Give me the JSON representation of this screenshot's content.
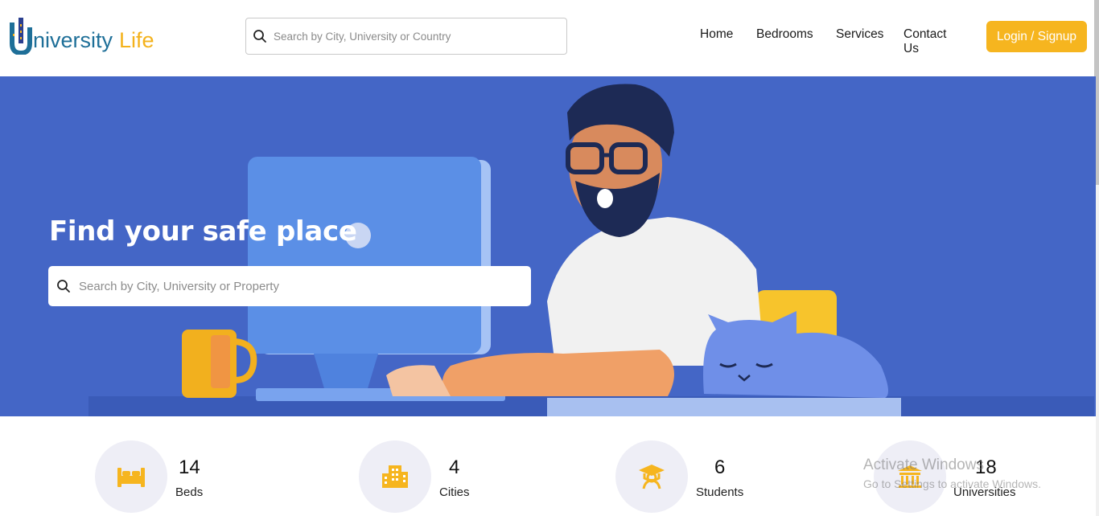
{
  "header": {
    "logo": {
      "text_1": "niversity",
      "text_2": "Life",
      "letter": "U"
    },
    "search": {
      "placeholder": "Search by City, University or Country",
      "value": ""
    },
    "nav": [
      {
        "label": "Home"
      },
      {
        "label": "Bedrooms"
      },
      {
        "label": "Services"
      },
      {
        "label": "Contact Us"
      }
    ],
    "login_label": "Login / Signup"
  },
  "hero": {
    "title": "Find your safe place",
    "search": {
      "placeholder": "Search by City, University or Property",
      "value": ""
    }
  },
  "stats": [
    {
      "value": "14",
      "label": "Beds",
      "icon": "bed-icon"
    },
    {
      "value": "4",
      "label": "Cities",
      "icon": "building-icon"
    },
    {
      "value": "6",
      "label": "Students",
      "icon": "graduate-icon"
    },
    {
      "value": "18",
      "label": "Universities",
      "icon": "university-icon"
    }
  ],
  "watermark": {
    "line_1": "Activate Windows",
    "line_2": "Go to Settings to activate Windows."
  },
  "colors": {
    "brand_blue": "#1e6f98",
    "brand_yellow": "#f4b21c",
    "hero_bg": "#4466c6",
    "icon_color": "#f6b51f",
    "stat_circle": "#eeeef6"
  }
}
